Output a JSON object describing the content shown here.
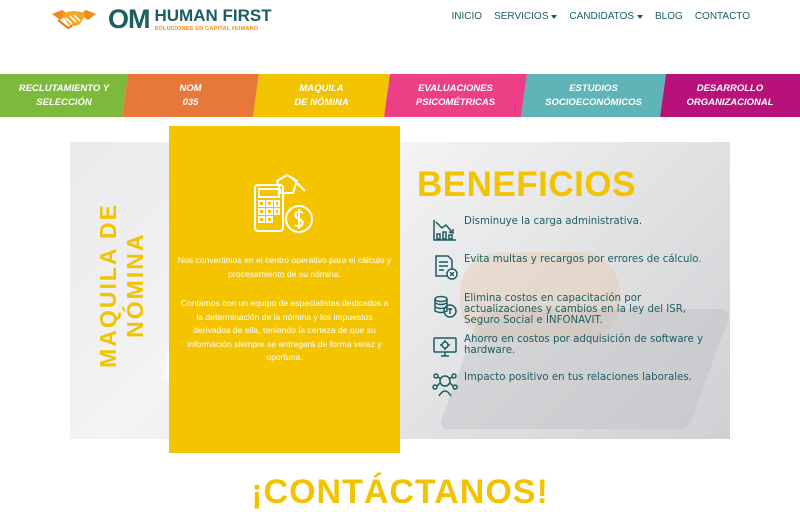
{
  "brand": {
    "om": "OM",
    "name": "HUMAN FIRST",
    "tagline": "SOLUCIONES EN CAPITAL HUMANO",
    "colors": {
      "teal": "#1d5d63",
      "orange": "#f08a1c",
      "yellow": "#f5c400"
    }
  },
  "nav": {
    "items": [
      {
        "label": "INICIO",
        "dropdown": false
      },
      {
        "label": "SERVICIOS",
        "dropdown": true
      },
      {
        "label": "CANDIDATOS",
        "dropdown": true
      },
      {
        "label": "BLOG",
        "dropdown": false
      },
      {
        "label": "CONTACTO",
        "dropdown": false
      }
    ]
  },
  "ribbon": [
    {
      "label": "RECLUTAMIENTO Y\nSELECCIÓN",
      "color": "#7dba3c"
    },
    {
      "label": "NOM\n035",
      "color": "#e8773a"
    },
    {
      "label": "MAQUILA\nDE NÓMINA",
      "color": "#f2c300"
    },
    {
      "label": "EVALUACIONES\nPSICOMÉTRICAS",
      "color": "#ec3f85"
    },
    {
      "label": "ESTUDIOS\nSOCIOECONÓMICOS",
      "color": "#5fb4b8"
    },
    {
      "label": "DESARROLLO\nORGANIZACIONAL",
      "color": "#b8127a"
    }
  ],
  "hero": {
    "vertical_title": "MAQUILA DE\nNÓMINA",
    "card_icon": "payroll-calculator-icon",
    "paragraph1": "Nos convertimos en el centro operativo para el cálculo y procesamiento de su nómina.",
    "paragraph2": "Contamos con un equipo de especialistas dedicados a la determinación de la nómina y los impuestos derivados de ella, teniendo la certeza de que su información siempre se entregará de forma veraz y oportuna."
  },
  "benefits": {
    "title": "BENEFICIOS",
    "items": [
      {
        "icon": "chart-down-icon",
        "text": "Disminuye la carga administrativa."
      },
      {
        "icon": "document-error-icon",
        "text": "Evita multas y recargos por errores de cálculo."
      },
      {
        "icon": "coins-icon",
        "text": "Elimina costos en capacitación por actualizaciones y cambios en la ley del ISR, Seguro Social e INFONAVIT."
      },
      {
        "icon": "computer-icon",
        "text": "Ahorro en costos por adquisición de software y hardware."
      },
      {
        "icon": "people-network-icon",
        "text": "Impacto positivo en tus relaciones laborales."
      }
    ]
  },
  "contact_heading": "¡CONTÁCTANOS!"
}
